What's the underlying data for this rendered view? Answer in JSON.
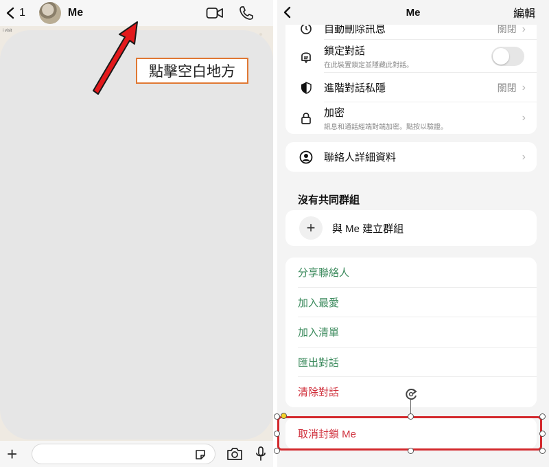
{
  "left": {
    "header": {
      "back_count": "1",
      "contact_name": "Me"
    },
    "peek_text": "i visit",
    "annotation": "點擊空白地方"
  },
  "right": {
    "header": {
      "title": "Me",
      "edit_label": "編輯"
    },
    "privacy_rows": [
      {
        "title": "自動刪除訊息",
        "value": "關閉",
        "icon": "timer-icon"
      },
      {
        "title": "鎖定對話",
        "subtitle": "在此裝置鎖定並隱藏此對話。",
        "icon": "lock-chat-icon",
        "toggle": "off"
      },
      {
        "title": "進階對話私隱",
        "value": "關閉",
        "icon": "shield-icon"
      },
      {
        "title": "加密",
        "subtitle": "訊息和通話經端對端加密。點按以驗證。",
        "icon": "padlock-icon"
      }
    ],
    "contact_details_label": "聯絡人詳細資料",
    "groups": {
      "section_title": "沒有共同群組",
      "create_label": "與 Me 建立群組"
    },
    "actions": [
      {
        "label": "分享聯絡人",
        "tone": "green"
      },
      {
        "label": "加入最愛",
        "tone": "green"
      },
      {
        "label": "加入清單",
        "tone": "green"
      },
      {
        "label": "匯出對話",
        "tone": "green"
      },
      {
        "label": "清除對話",
        "tone": "red"
      }
    ],
    "unblock_label": "取消封鎖 Me"
  },
  "colors": {
    "accent_green": "#3d8b5e",
    "destructive_red": "#d0313d",
    "annotation_border": "#e07833",
    "arrow_red": "#e3191c",
    "highlight_red": "#d3282c"
  }
}
